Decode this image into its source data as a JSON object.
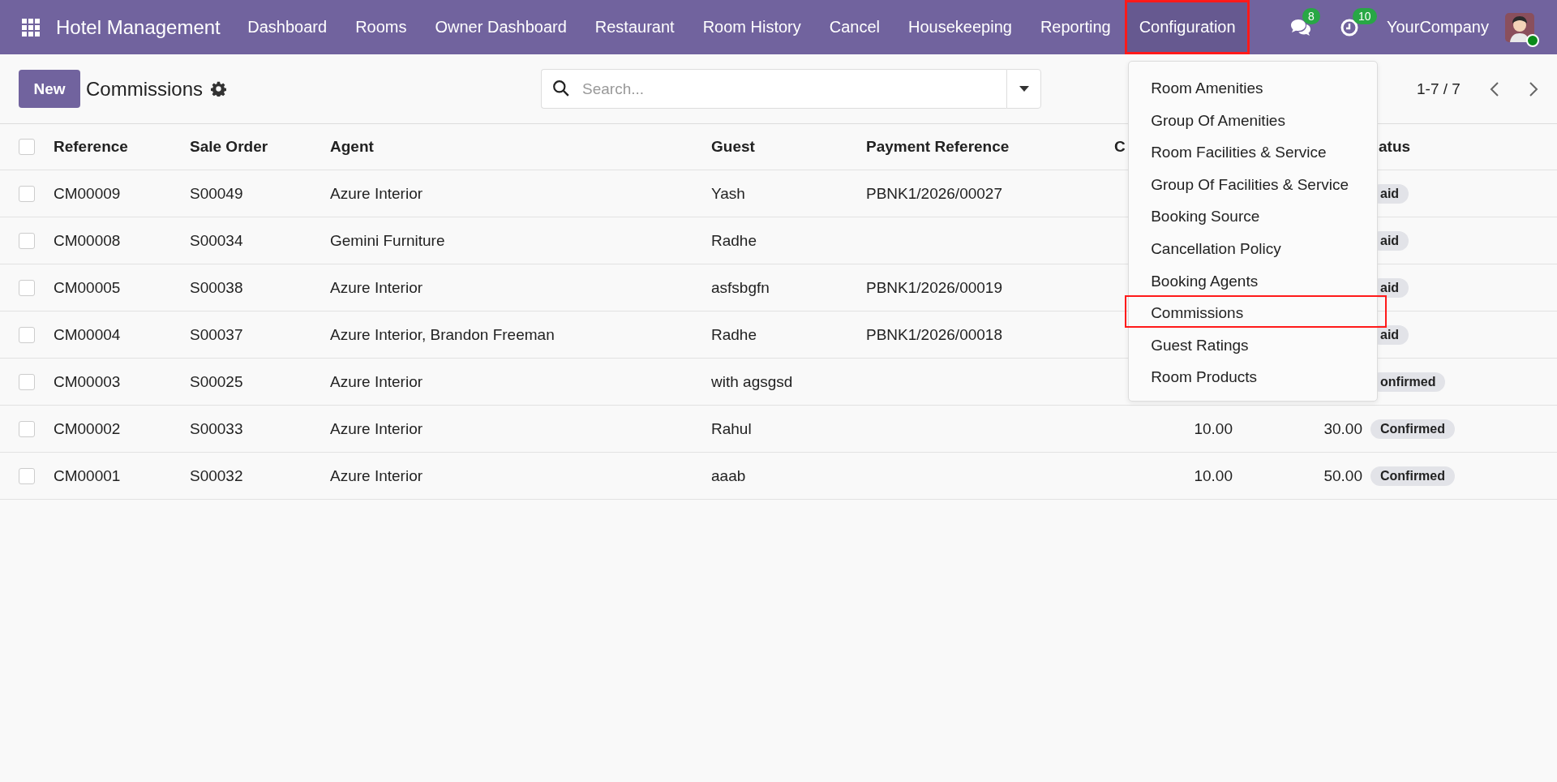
{
  "app": {
    "title": "Hotel Management"
  },
  "nav": [
    {
      "label": "Dashboard",
      "selected": false,
      "outlined": false
    },
    {
      "label": "Rooms",
      "selected": false,
      "outlined": false
    },
    {
      "label": "Owner Dashboard",
      "selected": false,
      "outlined": false
    },
    {
      "label": "Restaurant",
      "selected": false,
      "outlined": false
    },
    {
      "label": "Room History",
      "selected": false,
      "outlined": false
    },
    {
      "label": "Cancel",
      "selected": false,
      "outlined": false
    },
    {
      "label": "Housekeeping",
      "selected": false,
      "outlined": false
    },
    {
      "label": "Reporting",
      "selected": false,
      "outlined": false
    },
    {
      "label": "Configuration",
      "selected": true,
      "outlined": true
    }
  ],
  "systray": {
    "messages_count": "8",
    "activities_count": "10",
    "company": "YourCompany"
  },
  "config_menu": [
    {
      "label": "Room Amenities",
      "outlined": false
    },
    {
      "label": "Group Of Amenities",
      "outlined": false
    },
    {
      "label": "Room Facilities & Service",
      "outlined": false
    },
    {
      "label": "Group Of Facilities & Service",
      "outlined": false
    },
    {
      "label": "Booking Source",
      "outlined": false
    },
    {
      "label": "Cancellation Policy",
      "outlined": false
    },
    {
      "label": "Booking Agents",
      "outlined": false
    },
    {
      "label": "Commissions",
      "outlined": true
    },
    {
      "label": "Guest Ratings",
      "outlined": false
    },
    {
      "label": "Room Products",
      "outlined": false
    }
  ],
  "control_panel": {
    "new_button": "New",
    "title": "Commissions",
    "search": {
      "placeholder": "Search..."
    },
    "pager": "1-7 / 7"
  },
  "table": {
    "all_selected": false,
    "headers": {
      "reference": "Reference",
      "sale_order": "Sale Order",
      "agent": "Agent",
      "guest": "Guest",
      "payment_reference": "Payment Reference",
      "column_6": "C",
      "status": "atus"
    },
    "rows": [
      {
        "selected": false,
        "reference": "CM00009",
        "sale_order": "S00049",
        "agent": "Azure Interior",
        "guest": "Yash",
        "payment_reference": "PBNK1/2026/00027",
        "status": "aid"
      },
      {
        "selected": false,
        "reference": "CM00008",
        "sale_order": "S00034",
        "agent": "Gemini Furniture",
        "guest": "Radhe",
        "status": "aid"
      },
      {
        "selected": false,
        "reference": "CM00005",
        "sale_order": "S00038",
        "agent": "Azure Interior",
        "guest": "asfsbgfn",
        "payment_reference": "PBNK1/2026/00019",
        "status": "aid"
      },
      {
        "selected": false,
        "reference": "CM00004",
        "sale_order": "S00037",
        "agent": "Azure Interior, Brandon Freeman",
        "guest": "Radhe",
        "payment_reference": "PBNK1/2026/00018",
        "status": "aid"
      },
      {
        "selected": false,
        "reference": "CM00003",
        "sale_order": "S00025",
        "agent": "Azure Interior",
        "guest": "with agsgsd",
        "status": "onfirmed"
      },
      {
        "selected": false,
        "reference": "CM00002",
        "sale_order": "S00033",
        "agent": "Azure Interior",
        "guest": "Rahul",
        "column_6": "10.00",
        "column_7": "30.00",
        "status": "Confirmed"
      },
      {
        "selected": false,
        "reference": "CM00001",
        "sale_order": "S00032",
        "agent": "Azure Interior",
        "guest": "aaab",
        "column_6": "10.00",
        "column_7": "50.00",
        "status": "Confirmed"
      }
    ]
  }
}
